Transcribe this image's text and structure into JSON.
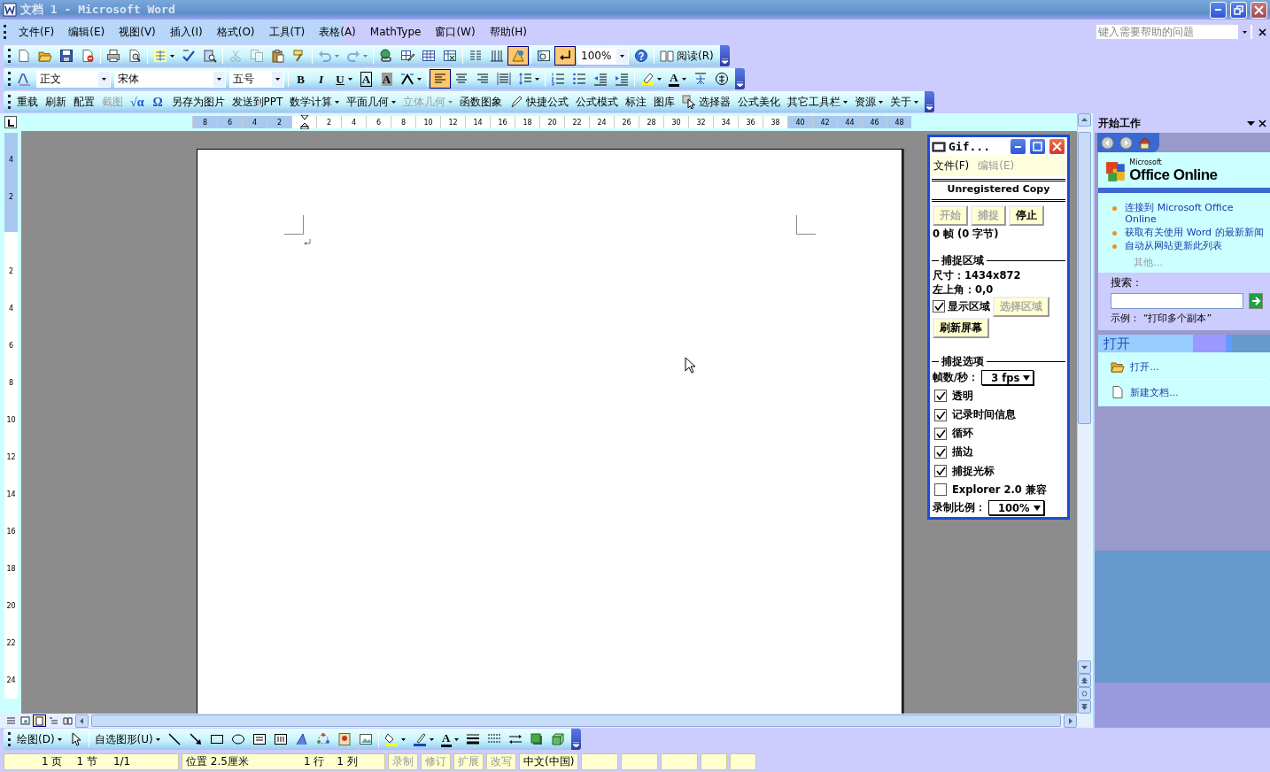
{
  "window": {
    "title": "文档 1 - Microsoft Word"
  },
  "menu_bar": {
    "items": [
      "文件(F)",
      "编辑(E)",
      "视图(V)",
      "插入(I)",
      "格式(O)",
      "工具(T)",
      "表格(A)",
      "MathType",
      "窗口(W)",
      "帮助(H)"
    ],
    "help_box": {
      "placeholder": "键入需要帮助的问题"
    }
  },
  "toolbars": [
    {
      "items": [
        {
          "kind": "icon",
          "pressed": false,
          "disabled": false
        },
        {
          "kind": "icon",
          "pressed": false,
          "disabled": false
        },
        {
          "kind": "icon",
          "pressed": false,
          "disabled": false
        },
        {
          "kind": "icon",
          "pressed": false,
          "disabled": false
        },
        {
          "kind": "sep"
        },
        {
          "kind": "icon",
          "pressed": false,
          "disabled": false
        },
        {
          "kind": "icon",
          "pressed": false,
          "disabled": false
        },
        {
          "kind": "sep"
        },
        {
          "kind": "icon-menu",
          "pressed": false,
          "disabled": false
        },
        {
          "kind": "icon",
          "pressed": false,
          "disabled": false
        },
        {
          "kind": "icon",
          "pressed": false,
          "disabled": false
        },
        {
          "kind": "sep"
        },
        {
          "kind": "icon",
          "pressed": false,
          "disabled": true
        },
        {
          "kind": "icon",
          "pressed": false,
          "disabled": true
        },
        {
          "kind": "icon",
          "pressed": false,
          "disabled": false
        },
        {
          "kind": "icon",
          "pressed": false,
          "disabled": false
        },
        {
          "kind": "sep"
        },
        {
          "kind": "icon-menu",
          "pressed": false,
          "disabled": true
        },
        {
          "kind": "icon-menu",
          "pressed": false,
          "disabled": true
        },
        {
          "kind": "sep"
        },
        {
          "kind": "icon",
          "pressed": false,
          "disabled": false
        },
        {
          "kind": "icon",
          "pressed": false,
          "disabled": false
        },
        {
          "kind": "icon",
          "pressed": false,
          "disabled": false
        },
        {
          "kind": "icon",
          "pressed": false,
          "disabled": false
        },
        {
          "kind": "sep"
        },
        {
          "kind": "icon",
          "pressed": false,
          "disabled": false
        },
        {
          "kind": "icon",
          "pressed": false,
          "disabled": false
        },
        {
          "kind": "icon",
          "pressed": true,
          "disabled": false
        },
        {
          "kind": "sep"
        },
        {
          "kind": "icon",
          "pressed": false,
          "disabled": false
        },
        {
          "kind": "icon",
          "pressed": true,
          "disabled": false
        },
        {
          "kind": "combo",
          "value": "100%"
        },
        {
          "kind": "icon",
          "pressed": false,
          "disabled": false
        },
        {
          "kind": "sep"
        },
        {
          "kind": "icon-text",
          "label": "阅读(R)",
          "pressed": false,
          "disabled": false
        }
      ]
    },
    {
      "items": [
        {
          "kind": "icon",
          "pressed": false,
          "disabled": false
        },
        {
          "kind": "combo",
          "value": "正文"
        },
        {
          "kind": "combo",
          "value": "宋体"
        },
        {
          "kind": "combo",
          "value": "五号"
        },
        {
          "kind": "sep"
        },
        {
          "kind": "glyph",
          "label": "B",
          "pressed": false,
          "disabled": false
        },
        {
          "kind": "glyph",
          "label": "I",
          "pressed": false,
          "disabled": false
        },
        {
          "kind": "glyph-menu",
          "label": "U",
          "pressed": false,
          "disabled": false
        },
        {
          "kind": "glyph",
          "label": "A",
          "pressed": false,
          "disabled": false
        },
        {
          "kind": "glyph",
          "label": "A",
          "pressed": false,
          "disabled": false
        },
        {
          "kind": "icon-menu",
          "pressed": false,
          "disabled": false
        },
        {
          "kind": "sep"
        },
        {
          "kind": "icon",
          "pressed": true,
          "disabled": false
        },
        {
          "kind": "icon",
          "pressed": false,
          "disabled": false
        },
        {
          "kind": "icon",
          "pressed": false,
          "disabled": false
        },
        {
          "kind": "icon",
          "pressed": false,
          "disabled": false
        },
        {
          "kind": "icon-menu",
          "pressed": false,
          "disabled": false
        },
        {
          "kind": "sep"
        },
        {
          "kind": "icon",
          "pressed": false,
          "disabled": false
        },
        {
          "kind": "icon",
          "pressed": false,
          "disabled": false
        },
        {
          "kind": "icon",
          "pressed": false,
          "disabled": false
        },
        {
          "kind": "icon",
          "pressed": false,
          "disabled": false
        },
        {
          "kind": "sep"
        },
        {
          "kind": "icon-menu",
          "pressed": false,
          "disabled": false
        },
        {
          "kind": "glyph-menu",
          "label": "A",
          "pressed": false,
          "disabled": false
        },
        {
          "kind": "icon",
          "pressed": false,
          "disabled": false
        },
        {
          "kind": "icon",
          "pressed": false,
          "disabled": false
        }
      ]
    },
    {
      "items": [
        {
          "kind": "text",
          "label": "重载",
          "pressed": false,
          "disabled": false
        },
        {
          "kind": "text",
          "label": "刷新",
          "pressed": false,
          "disabled": false
        },
        {
          "kind": "text",
          "label": "配置",
          "pressed": false,
          "disabled": false
        },
        {
          "kind": "text",
          "label": "截图",
          "pressed": false,
          "disabled": true
        },
        {
          "kind": "glyph",
          "label": "√α",
          "pressed": false,
          "disabled": false
        },
        {
          "kind": "glyph",
          "label": "Ω",
          "pressed": false,
          "disabled": false
        },
        {
          "kind": "text",
          "label": "另存为图片",
          "pressed": false,
          "disabled": false
        },
        {
          "kind": "text",
          "label": "发送到PPT",
          "pressed": false,
          "disabled": false
        },
        {
          "kind": "menu",
          "label": "数学计算",
          "pressed": false,
          "disabled": false
        },
        {
          "kind": "menu",
          "label": "平面几何",
          "pressed": false,
          "disabled": false
        },
        {
          "kind": "menu",
          "label": "立体几何",
          "pressed": false,
          "disabled": true
        },
        {
          "kind": "text",
          "label": "函数图象",
          "pressed": false,
          "disabled": false
        },
        {
          "kind": "icon-text",
          "label": "快捷公式",
          "pressed": false,
          "disabled": false
        },
        {
          "kind": "text",
          "label": "公式模式",
          "pressed": false,
          "disabled": false
        },
        {
          "kind": "text",
          "label": "标注",
          "pressed": false,
          "disabled": false
        },
        {
          "kind": "text",
          "label": "图库",
          "pressed": false,
          "disabled": false
        },
        {
          "kind": "icon-text",
          "label": "选择器",
          "pressed": false,
          "disabled": false
        },
        {
          "kind": "text",
          "label": "公式美化",
          "pressed": false,
          "disabled": false
        },
        {
          "kind": "menu",
          "label": "其它工具栏",
          "pressed": false,
          "disabled": false
        },
        {
          "kind": "menu",
          "label": "资源",
          "pressed": false,
          "disabled": false
        },
        {
          "kind": "menu",
          "label": "关于",
          "pressed": false,
          "disabled": false
        }
      ]
    }
  ],
  "ruler": {
    "left_numbers": [
      "8",
      "6",
      "4",
      "2"
    ],
    "right_numbers": [
      "2",
      "4",
      "6",
      "8",
      "10",
      "12",
      "14",
      "16",
      "18",
      "20",
      "22",
      "24",
      "26",
      "28",
      "30",
      "32",
      "34",
      "36",
      "38",
      "40",
      "42",
      "44",
      "46",
      "48"
    ],
    "vertical_top_numbers": [
      "4",
      "2"
    ],
    "vertical_numbers": [
      "2",
      "4",
      "6",
      "8",
      "10",
      "12",
      "14",
      "16",
      "18",
      "20",
      "22",
      "24"
    ]
  },
  "views": [
    {
      "selected": false
    },
    {
      "selected": false
    },
    {
      "selected": true
    },
    {
      "selected": false
    },
    {
      "selected": false
    }
  ],
  "gif_window": {
    "title": "Gif...",
    "menu": [
      {
        "label": "文件(F)",
        "disabled": false
      },
      {
        "label": "编辑(E)",
        "disabled": true
      }
    ],
    "banner": "Unregistered Copy",
    "buttons": [
      {
        "label": "开始",
        "disabled": true
      },
      {
        "label": "捕捉",
        "disabled": true
      },
      {
        "label": "停止",
        "disabled": false
      }
    ],
    "frame_info": "0 帧 (0 字节)",
    "capture_area": {
      "heading": "捕捉区域",
      "size": "尺寸：1434x872",
      "origin": "左上角：0,0",
      "show_area": {
        "label": "显示区域",
        "checked": true
      },
      "select_button": {
        "label": "选择区域",
        "disabled": true
      },
      "refresh_button": "刷新屏幕"
    },
    "capture_options": {
      "heading": "捕捉选项",
      "fps_label": "帧数/秒：",
      "fps": "3 fps",
      "options": [
        {
          "label": "透明",
          "checked": true
        },
        {
          "label": "记录时间信息",
          "checked": true
        },
        {
          "label": "循环",
          "checked": true
        },
        {
          "label": "描边",
          "checked": true
        },
        {
          "label": "捕捉光标",
          "checked": true
        },
        {
          "label": "Explorer 2.0 兼容",
          "checked": false
        }
      ],
      "scale_label": "录制比例：",
      "scale": "100%"
    }
  },
  "task_pane": {
    "title": "开始工作",
    "logo": {
      "small": "Microsoft",
      "name": "Office Online"
    },
    "links": [
      "连接到 Microsoft Office Online",
      "获取有关使用 Word 的最新新闻",
      "自动从网站更新此列表"
    ],
    "more": "其他...",
    "search": {
      "label": "搜索：",
      "example": "示例：  “打印多个副本”"
    },
    "open_section": {
      "title": "打开",
      "items": [
        "打开...",
        "新建文档..."
      ]
    }
  },
  "drawing_toolbar": {
    "items": [
      {
        "kind": "menu",
        "label": "绘图(D)",
        "pressed": false,
        "disabled": false
      },
      {
        "kind": "icon",
        "pressed": false,
        "disabled": false
      },
      {
        "kind": "sep"
      },
      {
        "kind": "menu",
        "label": "自选图形(U)",
        "pressed": false,
        "disabled": false
      },
      {
        "kind": "icon",
        "pressed": false,
        "disabled": false
      },
      {
        "kind": "icon",
        "pressed": false,
        "disabled": false
      },
      {
        "kind": "icon",
        "pressed": false,
        "disabled": false
      },
      {
        "kind": "icon",
        "pressed": false,
        "disabled": false
      },
      {
        "kind": "icon",
        "pressed": false,
        "disabled": false
      },
      {
        "kind": "icon",
        "pressed": false,
        "disabled": false
      },
      {
        "kind": "icon",
        "pressed": false,
        "disabled": false
      },
      {
        "kind": "icon",
        "pressed": false,
        "disabled": false
      },
      {
        "kind": "icon",
        "pressed": false,
        "disabled": false
      },
      {
        "kind": "icon",
        "pressed": false,
        "disabled": false
      },
      {
        "kind": "sep"
      },
      {
        "kind": "icon-menu",
        "pressed": false,
        "disabled": false
      },
      {
        "kind": "icon-menu",
        "pressed": false,
        "disabled": false
      },
      {
        "kind": "glyph-menu",
        "label": "A",
        "pressed": false,
        "disabled": false
      },
      {
        "kind": "icon",
        "pressed": false,
        "disabled": false
      },
      {
        "kind": "icon",
        "pressed": false,
        "disabled": false
      },
      {
        "kind": "icon",
        "pressed": false,
        "disabled": false
      },
      {
        "kind": "icon",
        "pressed": false,
        "disabled": false
      },
      {
        "kind": "icon",
        "pressed": false,
        "disabled": false
      }
    ]
  },
  "status_bar": {
    "page": "1 页",
    "section": "1 节",
    "pages": "1/1",
    "position": "位置 2.5厘米",
    "line": "1 行",
    "column": "1 列",
    "modes": [
      {
        "label": "录制",
        "disabled": true
      },
      {
        "label": "修订",
        "disabled": true
      },
      {
        "label": "扩展",
        "disabled": true
      },
      {
        "label": "改写",
        "disabled": true
      }
    ],
    "language": "中文(中国)"
  }
}
